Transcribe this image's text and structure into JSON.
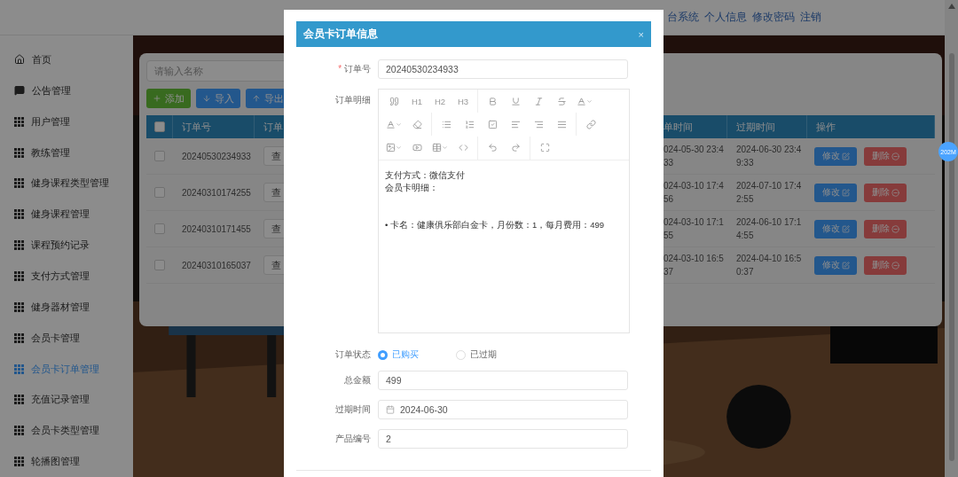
{
  "header": {
    "links": [
      "台系统",
      "个人信息",
      "修改密码",
      "注销"
    ]
  },
  "sidebar": {
    "items": [
      {
        "label": "首页",
        "selected": false
      },
      {
        "label": "公告管理",
        "selected": false
      },
      {
        "label": "用户管理",
        "selected": false
      },
      {
        "label": "教练管理",
        "selected": false
      },
      {
        "label": "健身课程类型管理",
        "selected": false
      },
      {
        "label": "健身课程管理",
        "selected": false
      },
      {
        "label": "课程预约记录",
        "selected": false
      },
      {
        "label": "支付方式管理",
        "selected": false
      },
      {
        "label": "健身器材管理",
        "selected": false
      },
      {
        "label": "会员卡管理",
        "selected": false
      },
      {
        "label": "会员卡订单管理",
        "selected": true
      },
      {
        "label": "充值记录管理",
        "selected": false
      },
      {
        "label": "会员卡类型管理",
        "selected": false
      },
      {
        "label": "轮播图管理",
        "selected": false
      }
    ]
  },
  "toolbar": {
    "search_placeholder": "请输入名称",
    "buttons": [
      {
        "label": "添加",
        "kind": "add"
      },
      {
        "label": "导入",
        "kind": "import"
      },
      {
        "label": "导出",
        "kind": "export"
      }
    ]
  },
  "table": {
    "select_all_checked": false,
    "columns": [
      "订单号",
      "订单",
      "单时间",
      "过期时间",
      "操作"
    ],
    "rows": [
      {
        "checked": false,
        "order_no": "20240530234933",
        "detail": "查",
        "order_time": "024-05-30 23:4\n33",
        "expire_time": "2024-06-30 23:4\n9:33",
        "edit": "修改",
        "delete": "删除"
      },
      {
        "checked": false,
        "order_no": "20240310174255",
        "detail": "查",
        "order_time": "024-03-10 17:4\n56",
        "expire_time": "2024-07-10 17:4\n2:55",
        "edit": "修改",
        "delete": "删除"
      },
      {
        "checked": false,
        "order_no": "20240310171455",
        "detail": "查",
        "order_time": "024-03-10 17:1\n55",
        "expire_time": "2024-06-10 17:1\n4:55",
        "edit": "修改",
        "delete": "删除"
      },
      {
        "checked": false,
        "order_no": "20240310165037",
        "detail": "查",
        "order_time": "024-03-10 16:5\n37",
        "expire_time": "2024-04-10 16:5\n0:37",
        "edit": "修改",
        "delete": "删除"
      }
    ]
  },
  "badge": "202M",
  "modal": {
    "title": "会员卡订单信息",
    "close": "×",
    "order_no": {
      "label": "订单号",
      "required_mark": "*",
      "value": "20240530234933"
    },
    "detail": {
      "label": "订单明细",
      "toolbar_labels": [
        "H1",
        "H2",
        "H3"
      ],
      "content": [
        {
          "kind": "line",
          "text": "支付方式：微信支付"
        },
        {
          "kind": "line",
          "text": "会员卡明细："
        },
        {
          "kind": "bullet",
          "marker": "•",
          "text": "卡名：健康俱乐部白金卡，月份数：1，每月费用：499"
        }
      ]
    },
    "status": {
      "label": "订单状态",
      "options": [
        {
          "label": "已购买",
          "selected": true
        },
        {
          "label": "已过期",
          "selected": false
        }
      ]
    },
    "total": {
      "label": "总金额",
      "value": "499"
    },
    "expire": {
      "label": "过期时间",
      "value": "2024-06-30"
    },
    "product": {
      "label": "产品编号",
      "value": "2"
    }
  }
}
